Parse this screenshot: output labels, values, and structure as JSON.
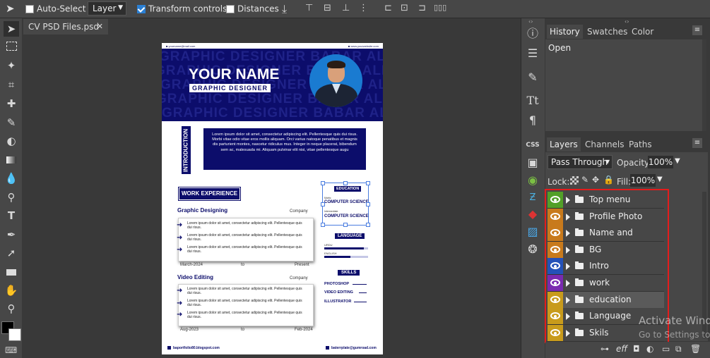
{
  "options_bar": {
    "auto_select_label": "Auto-Select",
    "auto_select_checked": false,
    "layer_select": "Layer",
    "transform_label": "Transform controls",
    "transform_checked": true,
    "distances_label": "Distances",
    "distances_checked": false
  },
  "document": {
    "tab_title": "CV PSD Files.psd",
    "close_glyph": "✕"
  },
  "resume": {
    "header_small_left": "■ yourname@mail.com",
    "header_small_right": "■ www.yourwebsite.com",
    "bg_text": "GRAPHIC DESIGNER BABAR ALI",
    "name": "YOUR NAME",
    "title": "GRAPHIC DESIGNER",
    "intro_label": "INTRODUCTION",
    "intro_text": "Lorem ipsum dolor sit amet, consectetur adipiscing elit. Pellentesque quis dui risus. Morbi vitae odio vitae eros mollis aliquam. Orci varius natoque penatibus et magnis dis parturient montes, nascetur ridiculus mus. Integer in neque placerat, bibendum sem ac, malesuada mi. Aliquam pulvinar elit nisi, vitae pellentesque augu",
    "work_heading": "WORK EXPERIENCE",
    "jobs": [
      {
        "title": "Graphic Designing",
        "company": "Company",
        "start": "March-2024",
        "to": "to",
        "end": "Present",
        "bullets": [
          "Lorem ipsum dolor sit amet, consectetur adipiscing elit. Pellentesque quis dui risus.",
          "Lorem ipsum dolor sit amet, consectetur adipiscing elit. Pellentesque quis dui risus.",
          "Lorem ipsum dolor sit amet, consectetur adipiscing elit. Pellentesque quis dui risus."
        ]
      },
      {
        "title": "Video Editing",
        "company": "Company",
        "start": "Aug-2023",
        "to": "to",
        "end": "Feb-2024",
        "bullets": [
          "Lorem ipsum dolor sit amet, consectetur adipiscing elit. Pellentesque quis dui risus.",
          "Lorem ipsum dolor sit amet, consectetur adipiscing elit. Pellentesque quis dui risus.",
          "Lorem ipsum dolor sit amet, consectetur adipiscing elit. Pellentesque quis dui risus."
        ]
      }
    ],
    "education_heading": "EDUCATION",
    "edu_1": "COMPUTER SCIENCE",
    "edu_2": "COMPUTER SCIENCE",
    "edu_1_sub": "Matric",
    "edu_2_sub": "Intermediate",
    "language_heading": "LANGUAGE",
    "languages": [
      {
        "name": "URDU",
        "level": 0.9
      },
      {
        "name": "ENGLISH",
        "level": 0.6
      }
    ],
    "skills_heading": "SKILLS",
    "skills": [
      "PHOTOSHOP",
      "VIDEO EDITING",
      "ILLUSTRATOR"
    ],
    "footer_left": "baportfolio80.blogspot.com",
    "footer_right": "baterrplate@gumroad.com"
  },
  "history_panel": {
    "tabs": [
      "History",
      "Swatches",
      "Color"
    ],
    "active": "History",
    "items": [
      "Open"
    ]
  },
  "layers_panel": {
    "tabs": [
      "Layers",
      "Channels",
      "Paths"
    ],
    "blend_mode": "Pass Through",
    "opacity_label": "Opacity:",
    "opacity_value": "100%",
    "lock_label": "Lock:",
    "fill_label": "Fill:",
    "fill_value": "100%",
    "layers": [
      {
        "name": "Top menu",
        "color": "#52a028",
        "selected": false
      },
      {
        "name": "Profile Photo",
        "color": "#c87a1c",
        "selected": false
      },
      {
        "name": "Name and Profession",
        "color": "#c87a1c",
        "selected": false
      },
      {
        "name": "BG",
        "color": "#c87a1c",
        "selected": false
      },
      {
        "name": "Intro",
        "color": "#2451b8",
        "selected": false
      },
      {
        "name": "work",
        "color": "#7a2ab0",
        "selected": false
      },
      {
        "name": "education",
        "color": "#c89b1c",
        "selected": true
      },
      {
        "name": "Language",
        "color": "#c89b1c",
        "selected": false
      },
      {
        "name": "Skils",
        "color": "#c89b1c",
        "selected": false
      }
    ]
  },
  "watermark": {
    "line1": "Activate Windows",
    "line2": "Go to Settings to activate Windows."
  },
  "bottom_icons": [
    "link-icon",
    "effects-icon",
    "mask-icon",
    "adjustment-icon",
    "folder-icon",
    "new-layer-icon",
    "trash-icon"
  ]
}
